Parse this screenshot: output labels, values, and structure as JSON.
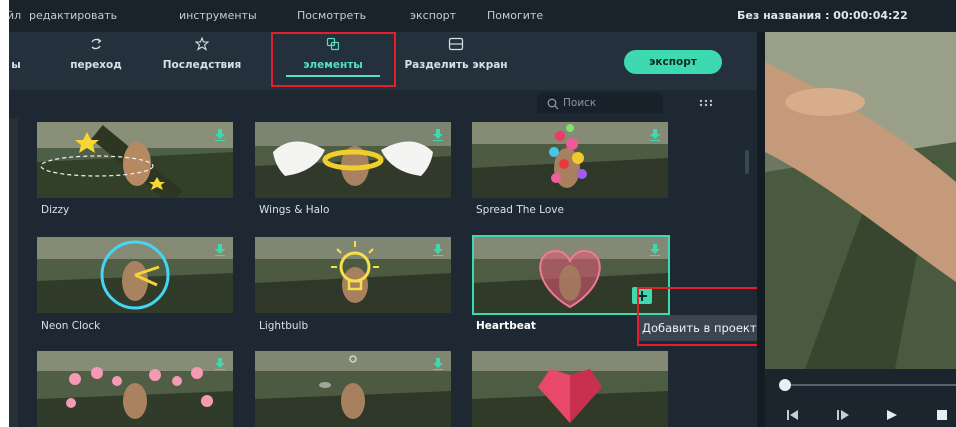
{
  "menu": {
    "items": [
      "йл",
      "редактировать",
      "инструменты",
      "Посмотреть",
      "экспорт",
      "Помогите"
    ],
    "window_title": "Без названия : 00:00:04:22"
  },
  "toolbar": {
    "tabs": [
      {
        "label": "ы",
        "icon": "none"
      },
      {
        "label": "переход",
        "icon": "transition-icon"
      },
      {
        "label": "Последствия",
        "icon": "effects-icon"
      },
      {
        "label": "элементы",
        "icon": "elements-icon"
      },
      {
        "label": "Разделить экран",
        "icon": "split-screen-icon"
      }
    ],
    "export_label": "экспорт"
  },
  "library": {
    "search_placeholder": "Поиск",
    "tiles": [
      {
        "label": "Dizzy"
      },
      {
        "label": "Wings & Halo"
      },
      {
        "label": "Spread The Love"
      },
      {
        "label": "Neon Clock"
      },
      {
        "label": "Lightbulb"
      },
      {
        "label": "Heartbeat"
      },
      {
        "label": ""
      },
      {
        "label": ""
      },
      {
        "label": ""
      }
    ],
    "tooltip": "Добавить в проект"
  },
  "colors": {
    "accent": "#3dd9b1",
    "highlight": "#e3202a",
    "panel": "#1e2832"
  }
}
